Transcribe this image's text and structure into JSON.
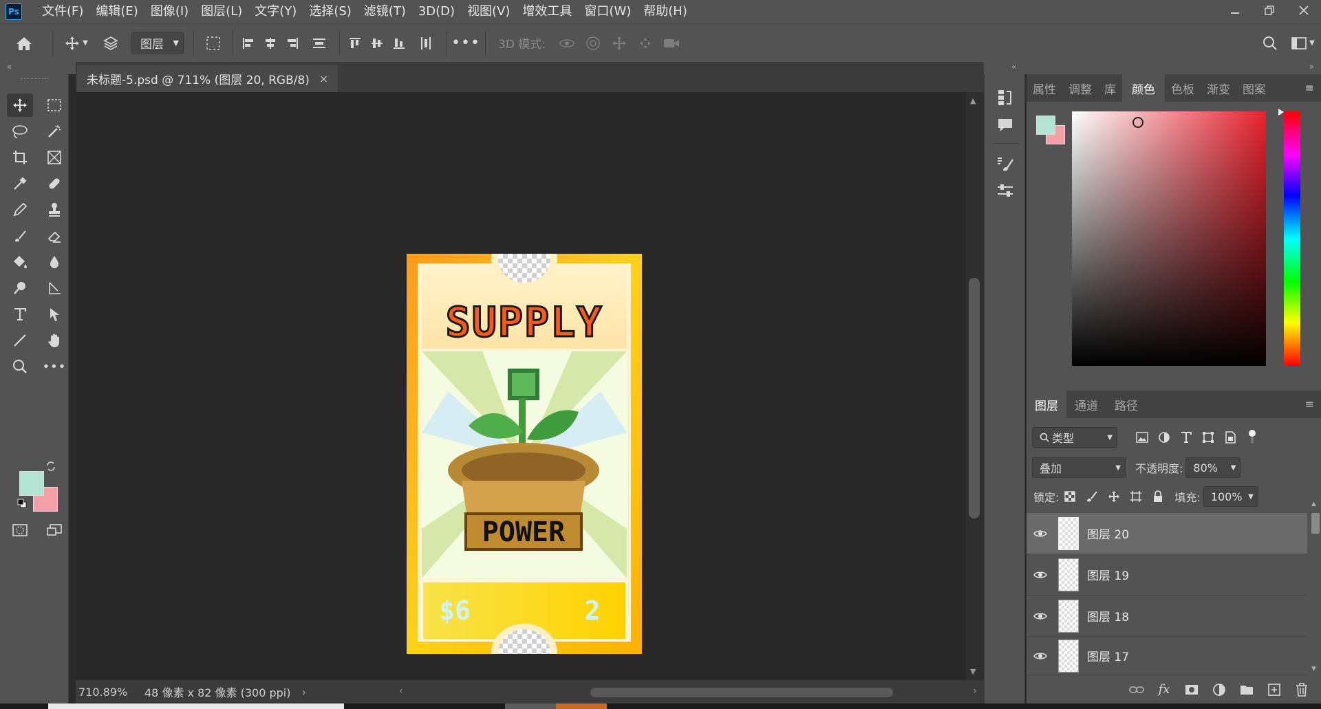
{
  "app": {
    "logo_text": "Ps"
  },
  "menu": [
    "文件(F)",
    "编辑(E)",
    "图像(I)",
    "图层(L)",
    "文字(Y)",
    "选择(S)",
    "滤镜(T)",
    "3D(D)",
    "视图(V)",
    "增效工具",
    "窗口(W)",
    "帮助(H)"
  ],
  "options_bar": {
    "layer_select": "图层",
    "mode_3d_label": "3D 模式:"
  },
  "document": {
    "tab_title": "未标题-5.psd @ 711% (图层 20, RGB/8)",
    "close_symbol": "×",
    "artwork_title": "SUPPLY",
    "artwork_label": "POWER",
    "artwork_price": "$6",
    "artwork_count": "2"
  },
  "status": {
    "zoom": "710.89%",
    "doc_size": "48 像素 x 82 像素 (300 ppi)"
  },
  "color_panel": {
    "tabs": [
      "属性",
      "调整",
      "库",
      "颜色",
      "色板",
      "渐变",
      "图案"
    ],
    "active_tab": "颜色",
    "foreground": "#b4e4d4",
    "background": "#f5a0a8"
  },
  "layers_panel": {
    "tabs": [
      "图层",
      "通道",
      "路径"
    ],
    "active_tab": "图层",
    "filter_kind": "类型",
    "blend_mode": "叠加",
    "opacity_label": "不透明度:",
    "opacity_value": "80%",
    "lock_label": "锁定:",
    "fill_label": "填充:",
    "fill_value": "100%",
    "layers": [
      {
        "name": "图层 20",
        "selected": true
      },
      {
        "name": "图层 19",
        "selected": false
      },
      {
        "name": "图层 18",
        "selected": false
      },
      {
        "name": "图层 17",
        "selected": false
      }
    ]
  }
}
